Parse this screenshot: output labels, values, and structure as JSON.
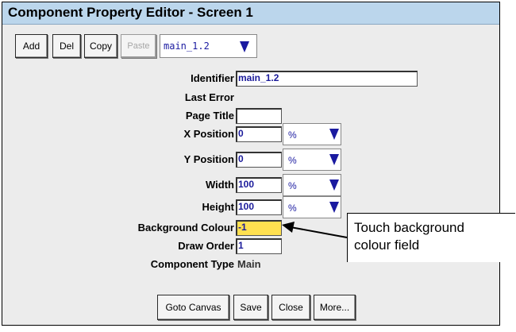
{
  "window": {
    "title": "Component Property Editor - Screen 1"
  },
  "toolbar": {
    "add_label": "Add",
    "del_label": "Del",
    "copy_label": "Copy",
    "paste_label": "Paste",
    "component_select_value": "main_1.2"
  },
  "form": {
    "identifier": {
      "label": "Identifier",
      "value": "main_1.2"
    },
    "last_error": {
      "label": "Last Error"
    },
    "page_title": {
      "label": "Page Title",
      "value": ""
    },
    "x_position": {
      "label": "X Position",
      "value": "0",
      "unit": "%"
    },
    "y_position": {
      "label": "Y Position",
      "value": "0",
      "unit": "%"
    },
    "width": {
      "label": "Width",
      "value": "100",
      "unit": "%"
    },
    "height": {
      "label": "Height",
      "value": "100",
      "unit": "%"
    },
    "background_colour": {
      "label": "Background Colour",
      "value": "-1",
      "highlight": "#ffe050"
    },
    "draw_order": {
      "label": "Draw Order",
      "value": "1"
    },
    "component_type": {
      "label": "Component Type",
      "value": "Main"
    }
  },
  "footer": {
    "goto_canvas_label": "Goto Canvas",
    "save_label": "Save",
    "close_label": "Close",
    "more_label": "More..."
  },
  "annotation": {
    "line1": "Touch background",
    "line2": "colour field"
  },
  "colors": {
    "title_bar": "#bbd6ec",
    "panel": "#ececec",
    "value_text": "#1a1a9a"
  }
}
